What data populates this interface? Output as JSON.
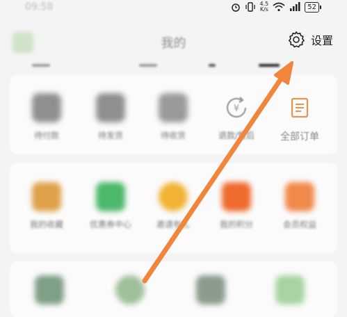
{
  "statusbar": {
    "time": "09:58",
    "net_speed_value": "4.5",
    "net_speed_unit": "K/s",
    "battery": "52"
  },
  "header": {
    "title": "我的",
    "settings_label": "设置"
  },
  "orders": {
    "items": [
      {
        "label": "待付款",
        "icon": "wallet-icon"
      },
      {
        "label": "待发货",
        "icon": "box-icon"
      },
      {
        "label": "待收货",
        "icon": "truck-icon"
      },
      {
        "label": "退款/售后",
        "icon": "refund-icon"
      },
      {
        "label": "全部订单",
        "icon": "order-list-icon"
      }
    ]
  },
  "services": {
    "items": [
      {
        "label": "我的收藏",
        "icon": "heart-icon",
        "color": "#e0a04a"
      },
      {
        "label": "优惠券中心",
        "icon": "coupon-icon",
        "color": "#4db86a"
      },
      {
        "label": "邀请有礼",
        "icon": "gift-icon",
        "color": "#f2b233"
      },
      {
        "label": "我的积分",
        "icon": "points-icon",
        "color": "#ef6a2e"
      },
      {
        "label": "会员权益",
        "icon": "vip-icon",
        "color": "#f0894a"
      }
    ]
  },
  "tools": {
    "items": [
      {
        "icon": "tool-icon-1",
        "color": "#7f9f86"
      },
      {
        "icon": "tool-icon-2",
        "color": "#9fbf9a"
      },
      {
        "icon": "tool-icon-3",
        "color": "#8a9b8c"
      },
      {
        "icon": "tool-icon-4",
        "color": "#a7d4a2"
      }
    ]
  },
  "colors": {
    "arrow": "#f0853b",
    "background": "#f4f4f4"
  }
}
